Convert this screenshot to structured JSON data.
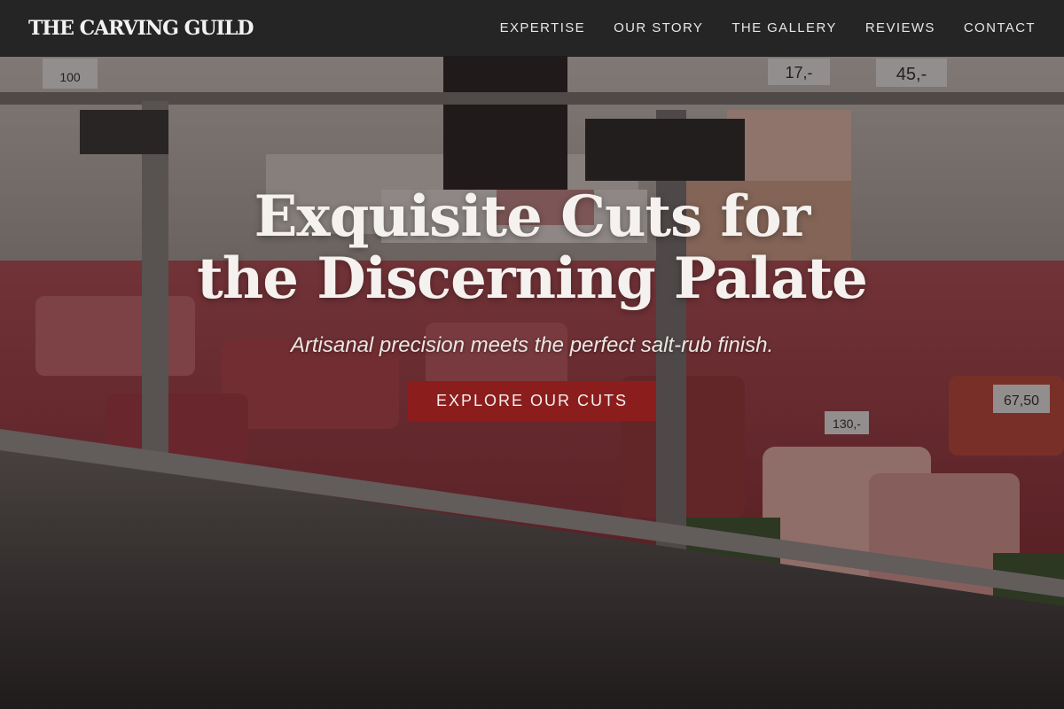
{
  "header": {
    "logo": "THE CARVING GUILD",
    "nav": [
      {
        "label": "EXPERTISE"
      },
      {
        "label": "OUR STORY"
      },
      {
        "label": "THE GALLERY"
      },
      {
        "label": "REVIEWS"
      },
      {
        "label": "CONTACT"
      }
    ]
  },
  "hero": {
    "headline": "Exquisite Cuts for the Discerning Palate",
    "tagline": "Artisanal precision meets the perfect salt-rub finish.",
    "cta_label": "EXPLORE OUR CUTS"
  },
  "price_tags": [
    "100",
    "17,-",
    "45,-",
    "67,50",
    "130,-"
  ],
  "colors": {
    "header_bg": "#252525",
    "cta_bg": "#8c1d1d",
    "text_light": "#f4f1ee"
  }
}
